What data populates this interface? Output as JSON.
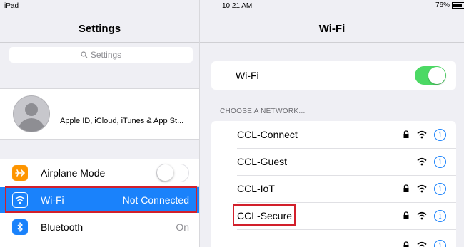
{
  "status_bar": {
    "device": "iPad",
    "time": "10:21 AM",
    "battery": "76%"
  },
  "colors": {
    "accent": "#1a82fb",
    "toggle_on": "#4cd964",
    "airplane": "#fe9500",
    "highlight_border": "#d21f2b"
  },
  "settings_pane": {
    "title": "Settings",
    "search_placeholder": "Settings",
    "profile": {
      "label": "Apple ID, iCloud, iTunes & App St..."
    },
    "items": [
      {
        "label": "Airplane Mode",
        "icon": "airplane-icon",
        "value": "",
        "toggle": "off"
      },
      {
        "label": "Wi-Fi",
        "icon": "wifi-icon",
        "value": "Not Connected",
        "selected": true
      },
      {
        "label": "Bluetooth",
        "icon": "bluetooth-icon",
        "value": "On"
      }
    ]
  },
  "wifi_pane": {
    "title": "Wi-Fi",
    "toggle_label": "Wi-Fi",
    "toggle_state": "on",
    "networks_header": "CHOOSE A NETWORK...",
    "networks": [
      {
        "name": "CCL-Connect",
        "secured": true
      },
      {
        "name": "CCL-Guest",
        "secured": false
      },
      {
        "name": "CCL-IoT",
        "secured": true
      },
      {
        "name": "CCL-Secure",
        "secured": true,
        "highlighted": true
      },
      {
        "name": "",
        "secured": true
      }
    ]
  }
}
